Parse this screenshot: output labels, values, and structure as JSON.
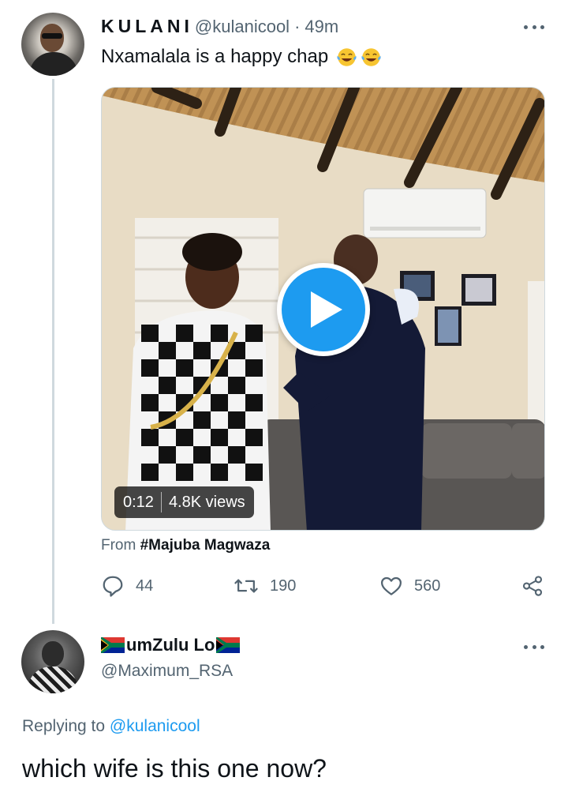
{
  "tweet": {
    "author": {
      "display_name": "KULANI",
      "handle": "@kulanicool",
      "separator": "·",
      "time": "49m"
    },
    "text": "Nxamalala is a happy chap",
    "emoji": [
      "face-with-tears-of-joy",
      "face-with-tears-of-joy"
    ],
    "video": {
      "duration": "0:12",
      "views": "4.8K views"
    },
    "source": {
      "prefix": "From",
      "hashtag": "#Majuba Magwaza"
    },
    "actions": {
      "replies": "44",
      "retweets": "190",
      "likes": "560"
    }
  },
  "reply": {
    "author": {
      "display_name": "umZulu Lo",
      "handle": "@Maximum_RSA",
      "flag": "south-africa-flag"
    },
    "replying_prefix": "Replying to",
    "replying_to": "@kulanicool",
    "text": "which wife is this one now?"
  },
  "colors": {
    "accent": "#1d9bf0",
    "secondary_text": "#536471",
    "primary_text": "#0f1419",
    "divider": "#cfd9de"
  }
}
